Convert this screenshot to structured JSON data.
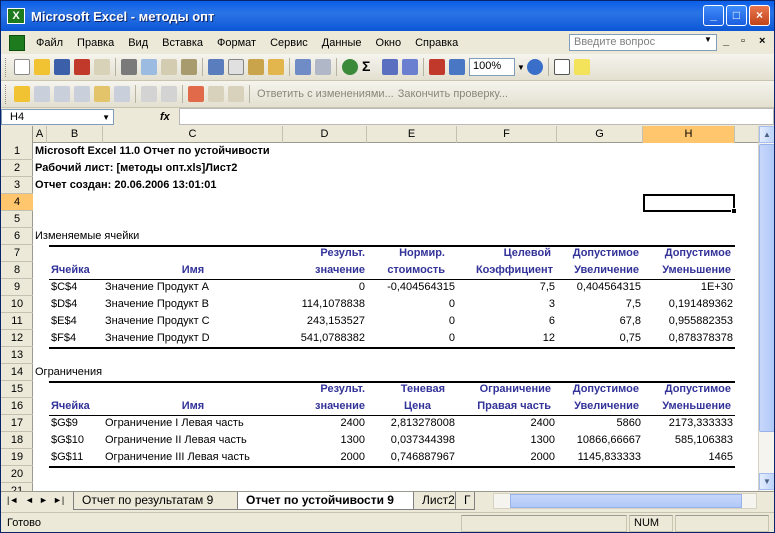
{
  "window": {
    "title": "Microsoft Excel - методы опт",
    "app_icon": "X",
    "buttons": {
      "minimize": "_",
      "maximize": "□",
      "close": "×"
    }
  },
  "menu": {
    "items": [
      "Файл",
      "Правка",
      "Вид",
      "Вставка",
      "Формат",
      "Сервис",
      "Данные",
      "Окно",
      "Справка"
    ],
    "help_placeholder": "Введите вопрос",
    "mdi_controls": [
      "_",
      "▫",
      "×"
    ]
  },
  "toolbar": {
    "zoom": "100%"
  },
  "review_toolbar": {
    "reply_label": "Ответить с изменениями...",
    "end_review_label": "Закончить проверку..."
  },
  "formula_bar": {
    "name_box": "H4",
    "fx": "fx",
    "value": ""
  },
  "columns": [
    "A",
    "B",
    "C",
    "D",
    "E",
    "F",
    "G",
    "H"
  ],
  "selected_column": "H",
  "rows": [
    "1",
    "2",
    "3",
    "4",
    "5",
    "6",
    "7",
    "8",
    "9",
    "10",
    "11",
    "12",
    "13",
    "14",
    "15",
    "16",
    "17",
    "18",
    "19",
    "20",
    "21"
  ],
  "selected_row": "4",
  "report": {
    "line1": "Microsoft Excel 11.0 Отчет по устойчивости",
    "line2": "Рабочий лист: [методы опт.xls]Лист2",
    "line3": "Отчет создан: 20.06.2006 13:01:01",
    "changeable_title": "Изменяемые ячейки",
    "changeable_headers_top": [
      "",
      "",
      "Результ.",
      "Нормир.",
      "Целевой",
      "Допустимое",
      "Допустимое"
    ],
    "changeable_headers_bottom": [
      "Ячейка",
      "Имя",
      "значение",
      "стоимость",
      "Коэффициент",
      "Увеличение",
      "Уменьшение"
    ],
    "changeable_rows": [
      [
        "$C$4",
        "Значение Продукт A",
        "0",
        "-0,404564315",
        "7,5",
        "0,404564315",
        "1E+30"
      ],
      [
        "$D$4",
        "Значение Продукт B",
        "114,1078838",
        "0",
        "3",
        "7,5",
        "0,191489362"
      ],
      [
        "$E$4",
        "Значение Продукт C",
        "243,153527",
        "0",
        "6",
        "67,8",
        "0,955882353"
      ],
      [
        "$F$4",
        "Значение Продукт D",
        "541,0788382",
        "0",
        "12",
        "0,75",
        "0,878378378"
      ]
    ],
    "constraints_title": "Ограничения",
    "constraints_headers_top": [
      "",
      "",
      "Результ.",
      "Теневая",
      "Ограничение",
      "Допустимое",
      "Допустимое"
    ],
    "constraints_headers_bottom": [
      "Ячейка",
      "Имя",
      "значение",
      "Цена",
      "Правая часть",
      "Увеличение",
      "Уменьшение"
    ],
    "constraints_rows": [
      [
        "$G$9",
        "Ограничение I Левая часть",
        "2400",
        "2,813278008",
        "2400",
        "5860",
        "2173,333333"
      ],
      [
        "$G$10",
        "Ограничение II Левая часть",
        "1300",
        "0,037344398",
        "1300",
        "10866,66667",
        "585,106383"
      ],
      [
        "$G$11",
        "Ограничение III Левая часть",
        "2000",
        "0,746887967",
        "2000",
        "1145,833333",
        "1465"
      ]
    ]
  },
  "sheet_tabs": [
    {
      "label": "Отчет по результатам 9",
      "active": false
    },
    {
      "label": "Отчет по устойчивости 9",
      "active": true
    },
    {
      "label": "Лист2",
      "active": false
    },
    {
      "label": "Г",
      "active": false
    }
  ],
  "status": {
    "text": "Готово",
    "num": "NUM"
  },
  "colors": {
    "title_bar": "#0a5ee8",
    "header_text": "#333399",
    "selection_header": "#ffc66e"
  }
}
